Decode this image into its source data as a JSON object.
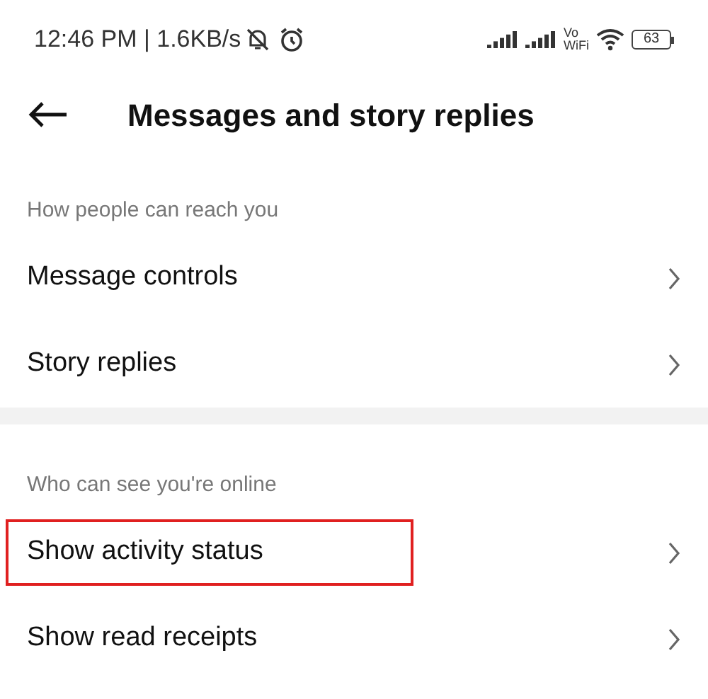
{
  "status_bar": {
    "time": "12:46 PM | 1.6KB/s",
    "volte": [
      "Vo",
      "WiFi"
    ],
    "battery": "63"
  },
  "header": {
    "title": "Messages and story replies"
  },
  "sections": [
    {
      "title": "How people can reach you",
      "items": [
        {
          "label": "Message controls",
          "highlighted": false
        },
        {
          "label": "Story replies",
          "highlighted": false
        }
      ]
    },
    {
      "title": "Who can see you're online",
      "items": [
        {
          "label": "Show activity status",
          "highlighted": true
        },
        {
          "label": "Show read receipts",
          "highlighted": false
        }
      ]
    }
  ]
}
